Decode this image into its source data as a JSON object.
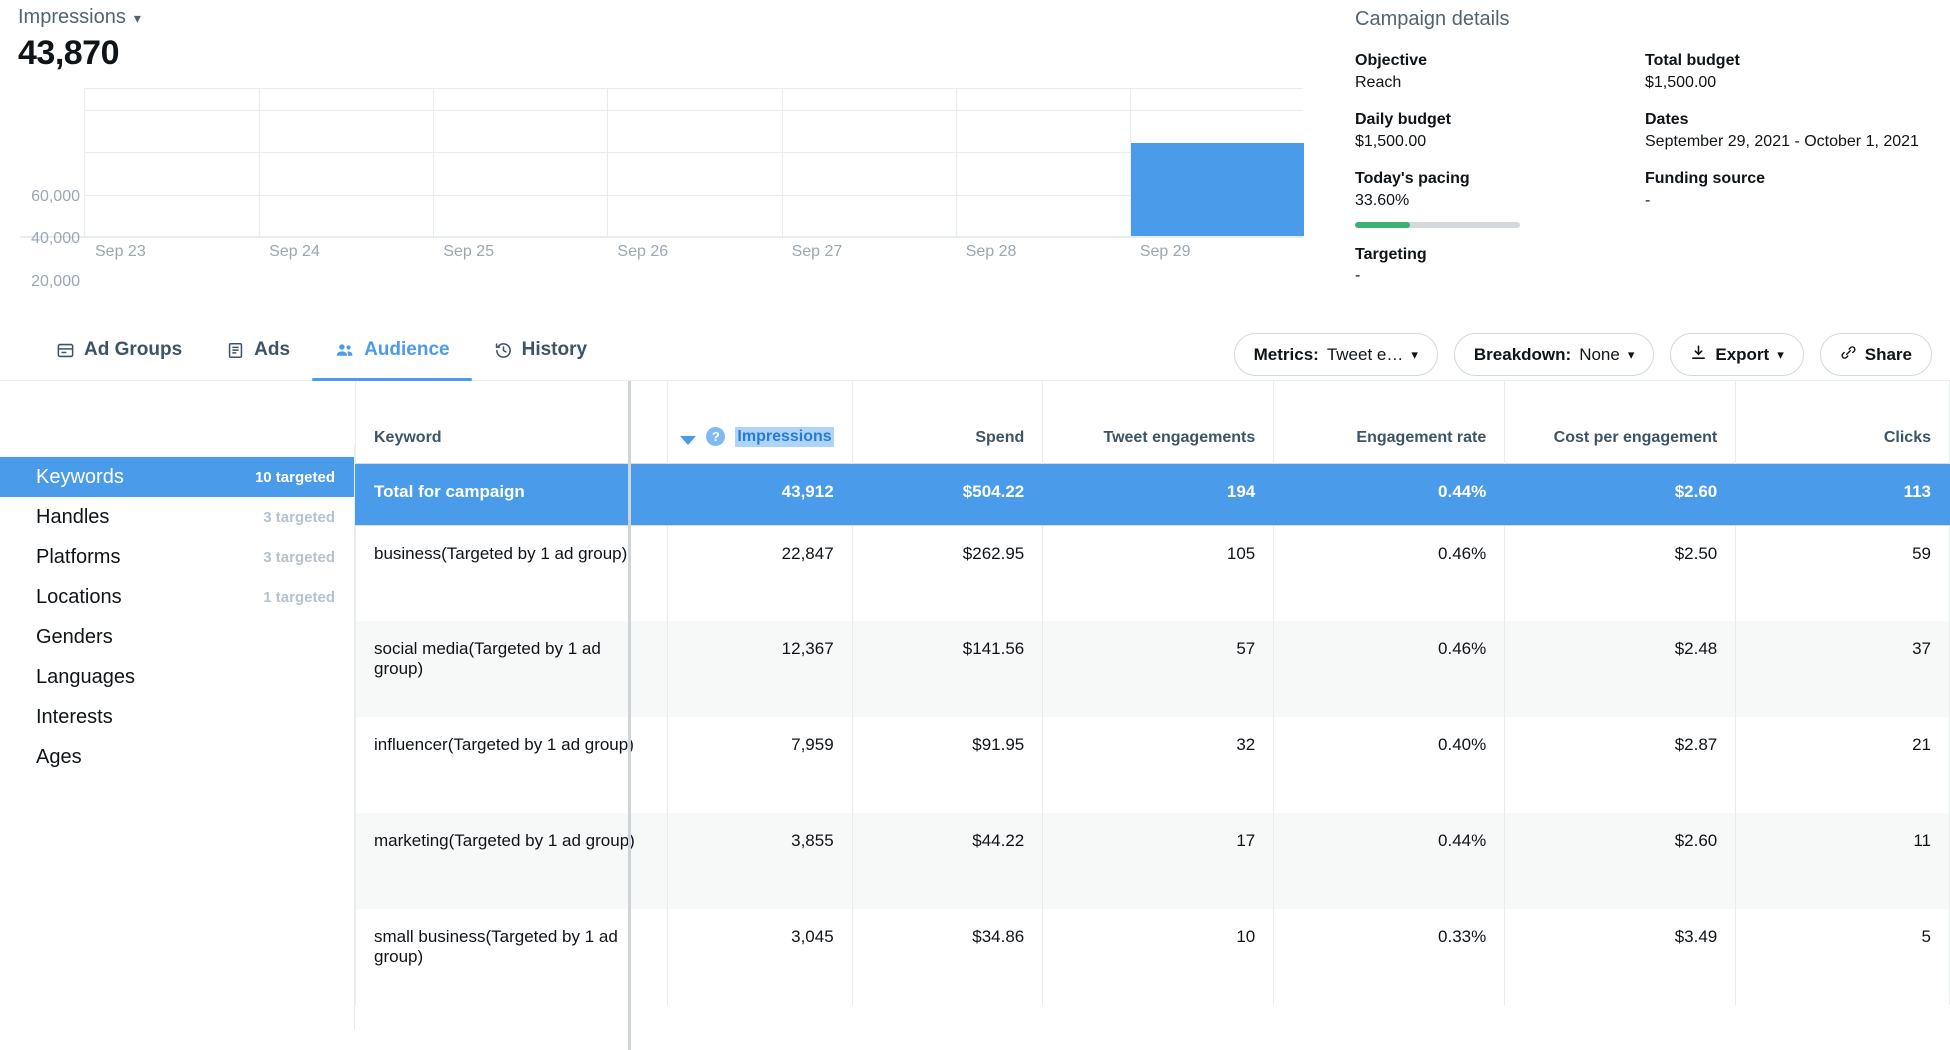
{
  "metric_header": {
    "metric_name": "Impressions",
    "chevron": "chevron-down",
    "value": "43,870"
  },
  "chart_data": {
    "type": "bar",
    "title": "Impressions",
    "xlabel": "",
    "ylabel": "",
    "categories": [
      "Sep 23",
      "Sep 24",
      "Sep 25",
      "Sep 26",
      "Sep 27",
      "Sep 28",
      "Sep 29"
    ],
    "values": [
      0,
      0,
      0,
      0,
      0,
      0,
      43870
    ],
    "ytick_labels": [
      "60,000",
      "40,000",
      "20,000"
    ],
    "ytick_values": [
      60000,
      40000,
      20000
    ],
    "ylim": [
      0,
      70000
    ],
    "grid": true,
    "legend": "none",
    "bar_color": "#4a9bea"
  },
  "campaign_details": {
    "title": "Campaign details",
    "left_column": [
      {
        "label": "Objective",
        "value": "Reach"
      },
      {
        "label": "Daily budget",
        "value": "$1,500.00"
      },
      {
        "label": "Today's pacing",
        "value": "33.60%",
        "progress_percent": 33.6
      },
      {
        "label": "Targeting",
        "value": "-"
      }
    ],
    "right_column": [
      {
        "label": "Total budget",
        "value": "$1,500.00"
      },
      {
        "label": "Dates",
        "value": "September 29, 2021 - October 1, 2021"
      },
      {
        "label": "Funding source",
        "value": "-"
      }
    ],
    "pacing_bar_color": "#3eaf72"
  },
  "tabs": [
    {
      "label": "Ad Groups",
      "icon": "ad-groups-icon",
      "active": false
    },
    {
      "label": "Ads",
      "icon": "ads-icon",
      "active": false
    },
    {
      "label": "Audience",
      "icon": "audience-icon",
      "active": true
    },
    {
      "label": "History",
      "icon": "history-icon",
      "active": false
    }
  ],
  "toolbar": {
    "metrics_prefix": "Metrics:",
    "metrics_value": "Tweet e…",
    "breakdown_prefix": "Breakdown:",
    "breakdown_value": "None",
    "export_label": "Export",
    "share_label": "Share",
    "chevron": "⌄"
  },
  "facets": [
    {
      "label": "Keywords",
      "count": "10 targeted",
      "active": true
    },
    {
      "label": "Handles",
      "count": "3 targeted",
      "active": false
    },
    {
      "label": "Platforms",
      "count": "3 targeted",
      "active": false
    },
    {
      "label": "Locations",
      "count": "1 targeted",
      "active": false
    },
    {
      "label": "Genders",
      "count": "",
      "active": false
    },
    {
      "label": "Languages",
      "count": "",
      "active": false
    },
    {
      "label": "Interests",
      "count": "",
      "active": false
    },
    {
      "label": "Ages",
      "count": "",
      "active": false
    }
  ],
  "table": {
    "columns": [
      {
        "key": "keyword",
        "label": "Keyword",
        "align": "left"
      },
      {
        "key": "impressions",
        "label": "Impressions",
        "align": "right",
        "sorted": true,
        "sort_direction": "desc",
        "selected": true,
        "has_help_icon": true
      },
      {
        "key": "spend",
        "label": "Spend",
        "align": "right"
      },
      {
        "key": "tweet_engagements",
        "label": "Tweet engagements",
        "align": "right"
      },
      {
        "key": "engagement_rate",
        "label": "Engagement rate",
        "align": "right"
      },
      {
        "key": "cost_per_engagement",
        "label": "Cost per engagement",
        "align": "right"
      },
      {
        "key": "clicks",
        "label": "Clicks",
        "align": "right"
      }
    ],
    "total_row": {
      "keyword": "Total for campaign",
      "impressions": "43,912",
      "spend": "$504.22",
      "tweet_engagements": "194",
      "engagement_rate": "0.44%",
      "cost_per_engagement": "$2.60",
      "clicks": "113"
    },
    "rows": [
      {
        "keyword": "business(Targeted by 1 ad group)",
        "impressions": "22,847",
        "spend": "$262.95",
        "tweet_engagements": "105",
        "engagement_rate": "0.46%",
        "cost_per_engagement": "$2.50",
        "clicks": "59"
      },
      {
        "keyword": "social media(Targeted by 1 ad group)",
        "impressions": "12,367",
        "spend": "$141.56",
        "tweet_engagements": "57",
        "engagement_rate": "0.46%",
        "cost_per_engagement": "$2.48",
        "clicks": "37"
      },
      {
        "keyword": "influencer(Targeted by 1 ad group)",
        "impressions": "7,959",
        "spend": "$91.95",
        "tweet_engagements": "32",
        "engagement_rate": "0.40%",
        "cost_per_engagement": "$2.87",
        "clicks": "21"
      },
      {
        "keyword": "marketing(Targeted by 1 ad group)",
        "impressions": "3,855",
        "spend": "$44.22",
        "tweet_engagements": "17",
        "engagement_rate": "0.44%",
        "cost_per_engagement": "$2.60",
        "clicks": "11"
      },
      {
        "keyword": "small business(Targeted by 1 ad group)",
        "impressions": "3,045",
        "spend": "$34.86",
        "tweet_engagements": "10",
        "engagement_rate": "0.33%",
        "cost_per_engagement": "$3.49",
        "clicks": "5"
      }
    ]
  },
  "colors": {
    "accent": "#4a9bea",
    "green": "#3eaf72",
    "text": "#0f1419",
    "muted": "#536471",
    "grid": "#e6ecf0"
  }
}
